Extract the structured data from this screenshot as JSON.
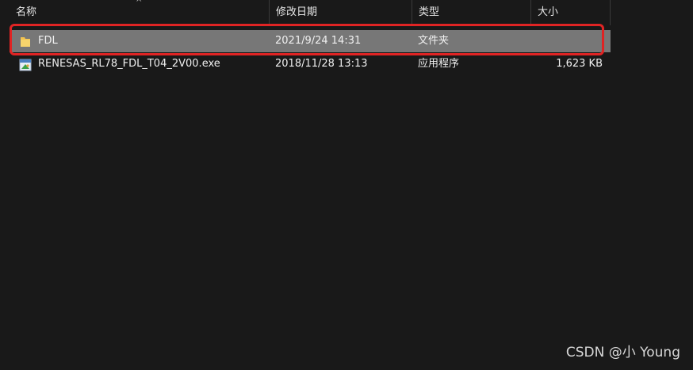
{
  "columns": {
    "name": "名称",
    "date": "修改日期",
    "type": "类型",
    "size": "大小",
    "sort_indicator": "^"
  },
  "files": [
    {
      "name": "FDL",
      "date": "2021/9/24 14:31",
      "type": "文件夹",
      "size": "",
      "icon": "folder-icon",
      "selected": true
    },
    {
      "name": "RENESAS_RL78_FDL_T04_2V00.exe",
      "date": "2018/11/28 13:13",
      "type": "应用程序",
      "size": "1,623 KB",
      "icon": "exe-icon",
      "selected": false
    }
  ],
  "colors": {
    "background": "#191919",
    "selected_row": "#777777",
    "highlight_border": "#e02424",
    "folder": "#f3c34f"
  },
  "watermark": "CSDN @小 Young"
}
